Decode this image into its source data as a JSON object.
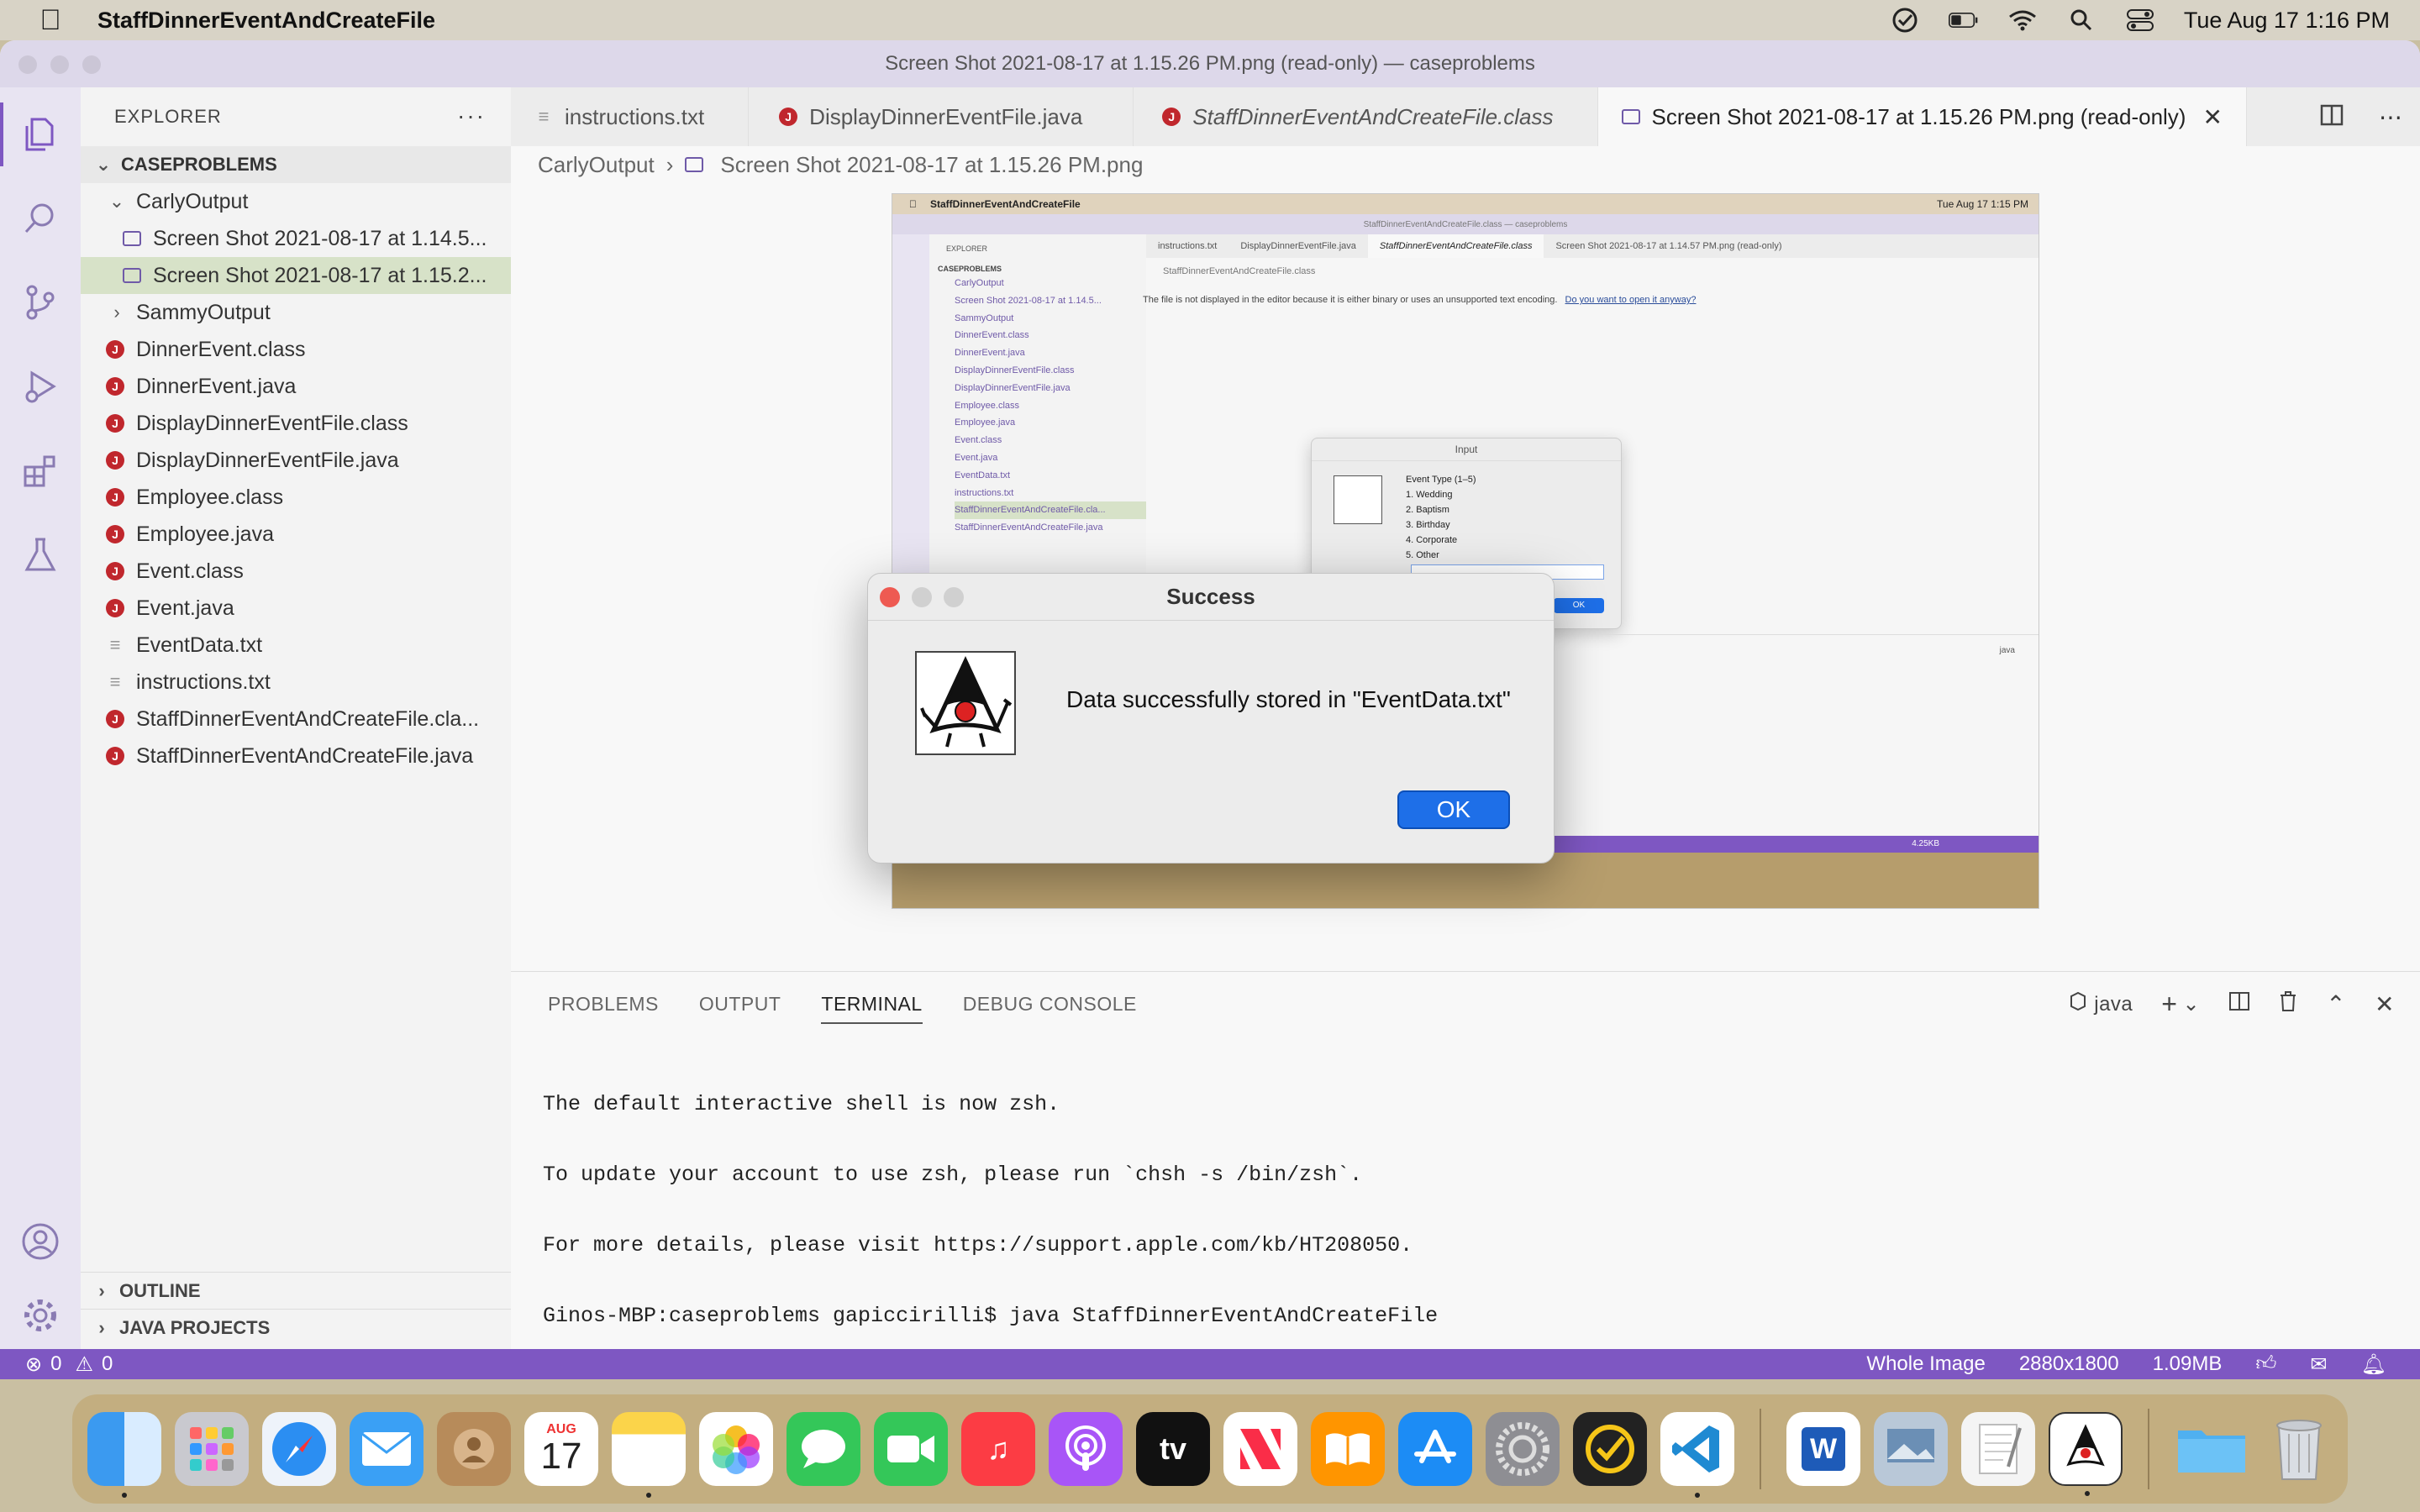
{
  "menubar": {
    "app_name": "StaffDinnerEventAndCreateFile",
    "clock": "Tue Aug 17  1:16 PM"
  },
  "window": {
    "title": "Screen Shot 2021-08-17 at 1.15.26 PM.png (read-only) — caseproblems"
  },
  "sidebar": {
    "header": "EXPLORER",
    "more": "···",
    "folder": "CASEPROBLEMS",
    "items": [
      {
        "label": "CarlyOutput",
        "kind": "folder-open"
      },
      {
        "label": "Screen Shot 2021-08-17 at 1.14.5...",
        "kind": "image"
      },
      {
        "label": "Screen Shot 2021-08-17 at 1.15.2...",
        "kind": "image"
      },
      {
        "label": "SammyOutput",
        "kind": "folder"
      },
      {
        "label": "DinnerEvent.class",
        "kind": "java"
      },
      {
        "label": "DinnerEvent.java",
        "kind": "java"
      },
      {
        "label": "DisplayDinnerEventFile.class",
        "kind": "java"
      },
      {
        "label": "DisplayDinnerEventFile.java",
        "kind": "java"
      },
      {
        "label": "Employee.class",
        "kind": "java"
      },
      {
        "label": "Employee.java",
        "kind": "java"
      },
      {
        "label": "Event.class",
        "kind": "java"
      },
      {
        "label": "Event.java",
        "kind": "java"
      },
      {
        "label": "EventData.txt",
        "kind": "text"
      },
      {
        "label": "instructions.txt",
        "kind": "text"
      },
      {
        "label": "StaffDinnerEventAndCreateFile.cla...",
        "kind": "java"
      },
      {
        "label": "StaffDinnerEventAndCreateFile.java",
        "kind": "java"
      }
    ],
    "outline": "OUTLINE",
    "java_projects": "JAVA PROJECTS"
  },
  "tabs": [
    {
      "label": "instructions.txt"
    },
    {
      "label": "DisplayDinnerEventFile.java"
    },
    {
      "label": "StaffDinnerEventAndCreateFile.class"
    },
    {
      "label": "Screen Shot 2021-08-17 at 1.15.26 PM.png (read-only)"
    }
  ],
  "breadcrumb": {
    "folder": "CarlyOutput",
    "file": "Screen Shot 2021-08-17 at 1.15.26 PM.png"
  },
  "inner_screenshot": {
    "menubar_app": "StaffDinnerEventAndCreateFile",
    "menubar_clock": "Tue Aug 17  1:15 PM",
    "title": "StaffDinnerEventAndCreateFile.class — caseproblems",
    "explorer": "EXPLORER",
    "folder": "CASEPROBLEMS",
    "items": [
      "CarlyOutput",
      "Screen Shot 2021-08-17 at 1.14.5...",
      "SammyOutput",
      "DinnerEvent.class",
      "DinnerEvent.java",
      "DisplayDinnerEventFile.class",
      "DisplayDinnerEventFile.java",
      "Employee.class",
      "Employee.java",
      "Event.class",
      "Event.java",
      "EventData.txt",
      "instructions.txt",
      "StaffDinnerEventAndCreateFile.cla...",
      "StaffDinnerEventAndCreateFile.java"
    ],
    "tabs": [
      "instructions.txt",
      "DisplayDinnerEventFile.java",
      "StaffDinnerEventAndCreateFile.class",
      "Screen Shot 2021-08-17 at 1.14.57 PM.png (read-only)"
    ],
    "breadcrumb": "StaffDinnerEventAndCreateFile.class",
    "message": "The file is not displayed in the editor because it is either binary or uses an unsupported text encoding.",
    "message_link": "Do you want to open it anyway?",
    "input_dialog": {
      "title": "Input",
      "prompt": "Event Type (1–5)",
      "options": [
        "1. Wedding",
        "2. Baptism",
        "3. Birthday",
        "4. Corporate",
        "5. Other"
      ],
      "ok": "OK"
    },
    "terminal_java": "java",
    "status_size": "4.25KB"
  },
  "dialog": {
    "title": "Success",
    "message": "Data successfully stored in \"EventData.txt\"",
    "ok": "OK"
  },
  "panel": {
    "tabs": [
      "PROBLEMS",
      "OUTPUT",
      "TERMINAL",
      "DEBUG CONSOLE"
    ],
    "active_tab": "TERMINAL",
    "shell_label": "java",
    "terminal_lines": [
      "The default interactive shell is now zsh.",
      "To update your account to use zsh, please run `chsh -s /bin/zsh`.",
      "For more details, please visit https://support.apple.com/kb/HT208050.",
      "Ginos-MBP:caseproblems gapiccirilli$ java StaffDinnerEventAndCreateFile"
    ]
  },
  "statusbar": {
    "errors": "0",
    "warnings": "0",
    "image_mode": "Whole Image",
    "dimensions": "2880x1800",
    "filesize": "1.09MB"
  },
  "dock": {
    "calendar_month": "AUG",
    "calendar_day": "17",
    "tv_label": "tv",
    "word_label": "W"
  },
  "colors": {
    "accent": "#7e57c2",
    "selection": "#d7e2c8",
    "java_icon": "#c0272d",
    "ok_button": "#1e6fe8"
  }
}
